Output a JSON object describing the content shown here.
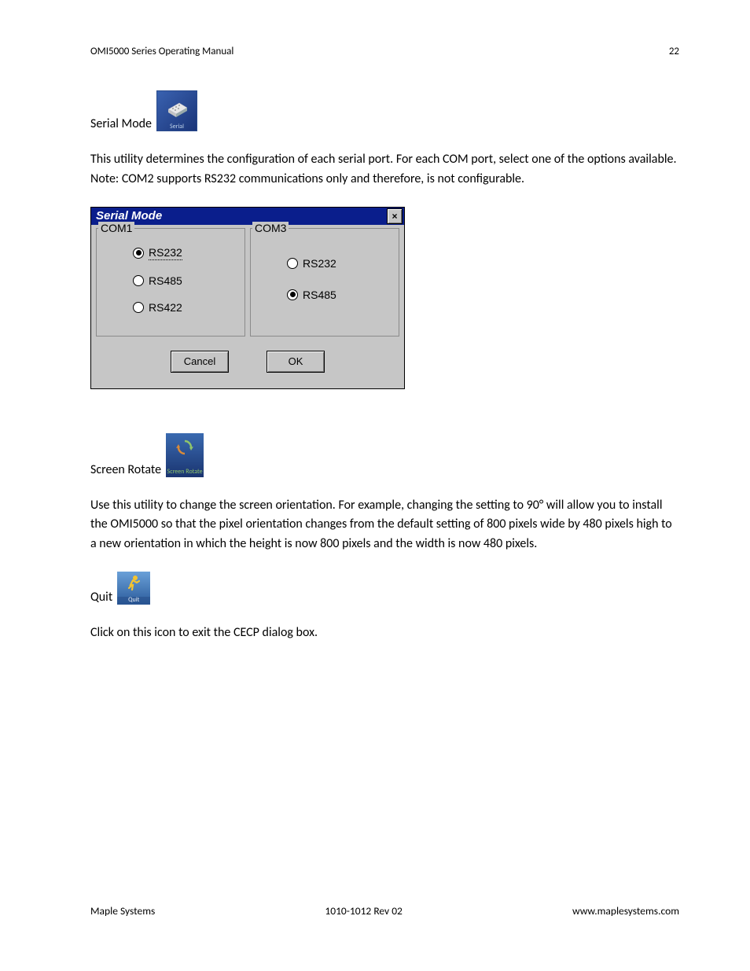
{
  "header": {
    "title": "OMI5000 Series Operating Manual",
    "page_number": "22"
  },
  "sections": {
    "serial_mode": {
      "label": "Serial Mode",
      "icon_caption": "Serial",
      "description": "This utility determines the configuration of each serial port.  For each COM port, select one of the options available.  Note: COM2 supports RS232 communications only and therefore, is not configurable."
    },
    "screen_rotate": {
      "label": "Screen Rotate",
      "icon_caption": "Screen Rotate",
      "description": "Use this utility to change the screen orientation.  For example, changing the setting to 90° will allow you to install the OMI5000 so that the pixel orientation changes from the default setting of 800 pixels wide by 480 pixels high to a new orientation in which the height is now 800 pixels and the width is now 480 pixels."
    },
    "quit": {
      "label": "Quit",
      "icon_caption": "Quit",
      "description": "Click on this icon to exit the CECP dialog box."
    }
  },
  "dialog": {
    "title": "Serial Mode",
    "close_symbol": "×",
    "com1": {
      "legend": "COM1",
      "options": {
        "rs232": "RS232",
        "rs485": "RS485",
        "rs422": "RS422"
      },
      "selected": "rs232"
    },
    "com3": {
      "legend": "COM3",
      "options": {
        "rs232": "RS232",
        "rs485": "RS485"
      },
      "selected": "rs485"
    },
    "buttons": {
      "cancel": "Cancel",
      "ok": "OK"
    }
  },
  "footer": {
    "left": "Maple Systems",
    "center": "1010-1012 Rev 02",
    "right": "www.maplesystems.com"
  }
}
